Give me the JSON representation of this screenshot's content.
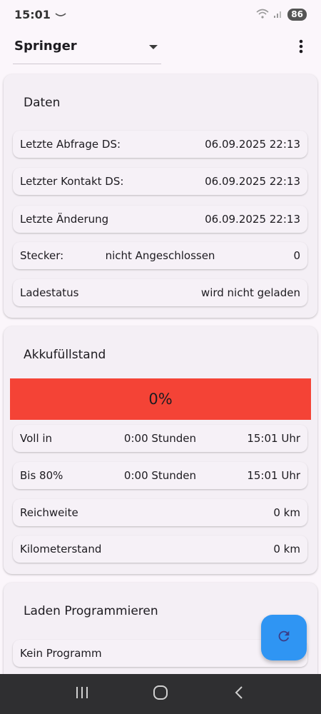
{
  "status_bar": {
    "time": "15:01",
    "battery": "86"
  },
  "vehicle_select": {
    "value": "Springer"
  },
  "daten": {
    "title": "Daten",
    "rows": [
      {
        "label": "Letzte Abfrage DS:",
        "value": "06.09.2025 22:13"
      },
      {
        "label": "Letzter Kontakt DS:",
        "value": "06.09.2025 22:13"
      },
      {
        "label": "Letzte Änderung",
        "value": "06.09.2025 22:13"
      },
      {
        "label": "Stecker:",
        "middle": "nicht Angeschlossen",
        "value": "0"
      },
      {
        "label": "Ladestatus",
        "value": "wird nicht geladen"
      }
    ]
  },
  "akku": {
    "title": "Akkufüllstand",
    "level_text": "0%",
    "level_fraction": 0,
    "level_color": "#f44336",
    "rows": [
      {
        "label": "Voll in",
        "middle": "0:00 Stunden",
        "value": "15:01 Uhr"
      },
      {
        "label": "Bis 80%",
        "middle": "0:00 Stunden",
        "value": "15:01 Uhr"
      },
      {
        "label": "Reichweite",
        "value": "0 km"
      },
      {
        "label": "Kilometerstand",
        "value": "0 km"
      }
    ]
  },
  "laden": {
    "title": "Laden Programmieren",
    "rows": [
      {
        "label": "Kein Programm"
      }
    ]
  },
  "icons": {
    "fab": "refresh-icon",
    "menu": "more-vert-icon",
    "dropdown": "arrow-drop-down-icon",
    "nav": [
      "recent-apps-icon",
      "home-icon",
      "back-icon"
    ]
  },
  "colors": {
    "accent": "#2f95f3",
    "level": "#f44336",
    "nav_bar": "#2f2f31"
  }
}
